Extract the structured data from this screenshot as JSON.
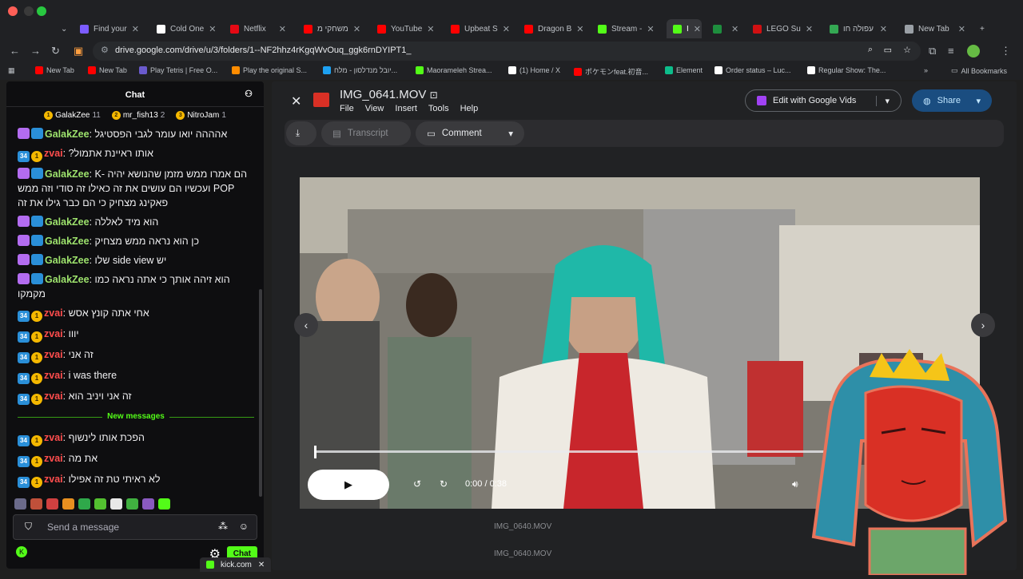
{
  "browser": {
    "tabs": [
      {
        "label": "Find your",
        "color": "#7c5cff"
      },
      {
        "label": "Cold One",
        "color": "#ffffff"
      },
      {
        "label": "Netflix",
        "color": "#e50914"
      },
      {
        "label": "משחקי מ",
        "color": "#ff0000"
      },
      {
        "label": "YouTube",
        "color": "#ff0000"
      },
      {
        "label": "Upbeat S",
        "color": "#ff0000"
      },
      {
        "label": "Dragon B",
        "color": "#ff0000"
      },
      {
        "label": "Stream -",
        "color": "#53fc18"
      },
      {
        "label": "I",
        "color": "#53fc18"
      },
      {
        "label": "",
        "color": "#1e8e3e"
      },
      {
        "label": "LEGO Su",
        "color": "#d01012"
      },
      {
        "label": "עפולה חו",
        "color": "#34a853"
      },
      {
        "label": "New Tab",
        "color": "#9aa0a6"
      }
    ],
    "url": "drive.google.com/drive/u/3/folders/1--NF2hhz4rKgqWvOuq_ggk6rnDYIPT1_",
    "bookmarks": [
      {
        "label": "New Tab",
        "color": "#ff0000"
      },
      {
        "label": "New Tab",
        "color": "#ff0000"
      },
      {
        "label": "Play Tetris | Free O...",
        "color": "#6a5acd"
      },
      {
        "label": "Play the original S...",
        "color": "#ff8c00"
      },
      {
        "label": "יובל מנדלסון - מלח...",
        "color": "#1da1f2"
      },
      {
        "label": "Maorameleh Strea...",
        "color": "#53fc18"
      },
      {
        "label": "(1) Home / X",
        "color": "#ffffff"
      },
      {
        "label": "ポケモンfeat.初音...",
        "color": "#ff0000"
      },
      {
        "label": "Element",
        "color": "#0dbd8b"
      },
      {
        "label": "Order status – Luc...",
        "color": "#ffffff"
      },
      {
        "label": "Regular Show: The...",
        "color": "#ffffff"
      }
    ],
    "all_bookmarks": "All Bookmarks"
  },
  "chat": {
    "title": "Chat",
    "top_gifters": [
      {
        "name": "GalakZee",
        "count": "11"
      },
      {
        "name": "mr_fish13",
        "count": "2"
      },
      {
        "name": "NitroJam",
        "count": "1"
      }
    ],
    "messages": [
      {
        "user": "GalakZee",
        "type": "g",
        "text": "אהההה יואו עומר לגבי הפסטיגל"
      },
      {
        "user": "zvai",
        "type": "z",
        "text": "אותו ראיינת אתמול?"
      },
      {
        "user": "GalakZee",
        "type": "g",
        "text": "הם אמרו ממש מזמן שהנושא יהיה K-POP ועכשיו הם עושים את זה כאילו זה סודי וזה ממש פאקינג מצחיק כי הם כבר גילו את זה"
      },
      {
        "user": "GalakZee",
        "type": "g",
        "text": "הוא מיד לאללה"
      },
      {
        "user": "GalakZee",
        "type": "g",
        "text": "כן הוא נראה ממש מצחיק"
      },
      {
        "user": "GalakZee",
        "type": "g",
        "text": "יש side view שלו"
      },
      {
        "user": "GalakZee",
        "type": "g",
        "text": "הוא זיהה אותך כי אתה נראה כמו מקמקו"
      },
      {
        "user": "zvai",
        "type": "z",
        "text": "אחי אתה קונץ אסש"
      },
      {
        "user": "zvai",
        "type": "z",
        "text": "יווו"
      },
      {
        "user": "zvai",
        "type": "z",
        "text": "זה אני"
      },
      {
        "user": "zvai",
        "type": "z",
        "text": "i was there"
      },
      {
        "user": "zvai",
        "type": "z",
        "text": "זה אני ויניב הוא"
      }
    ],
    "new_messages_label": "New messages",
    "new_messages": [
      {
        "user": "zvai",
        "type": "z",
        "text": "הפכת אותו לינשוף"
      },
      {
        "user": "zvai",
        "type": "z",
        "text": "את מה"
      },
      {
        "user": "zvai",
        "type": "z",
        "text": "לא ראיתי טת זה אפילו"
      }
    ],
    "sub_months": "34",
    "coin_level": "1",
    "input_placeholder": "Send a message",
    "chat_button": "Chat",
    "bottom_tab": "kick.com"
  },
  "drive": {
    "file_title": "IMG_0641.MOV",
    "menus": [
      "File",
      "View",
      "Insert",
      "Tools",
      "Help"
    ],
    "edit_button": "Edit with Google Vids",
    "share_button": "Share",
    "transcript_button": "Transcript",
    "comment_button": "Comment",
    "time_display": "0:00 / 0:38",
    "progress_fraction": 0.0,
    "background_files": [
      "IMG_0640.MOV",
      "IMG_0640.MOV"
    ]
  }
}
